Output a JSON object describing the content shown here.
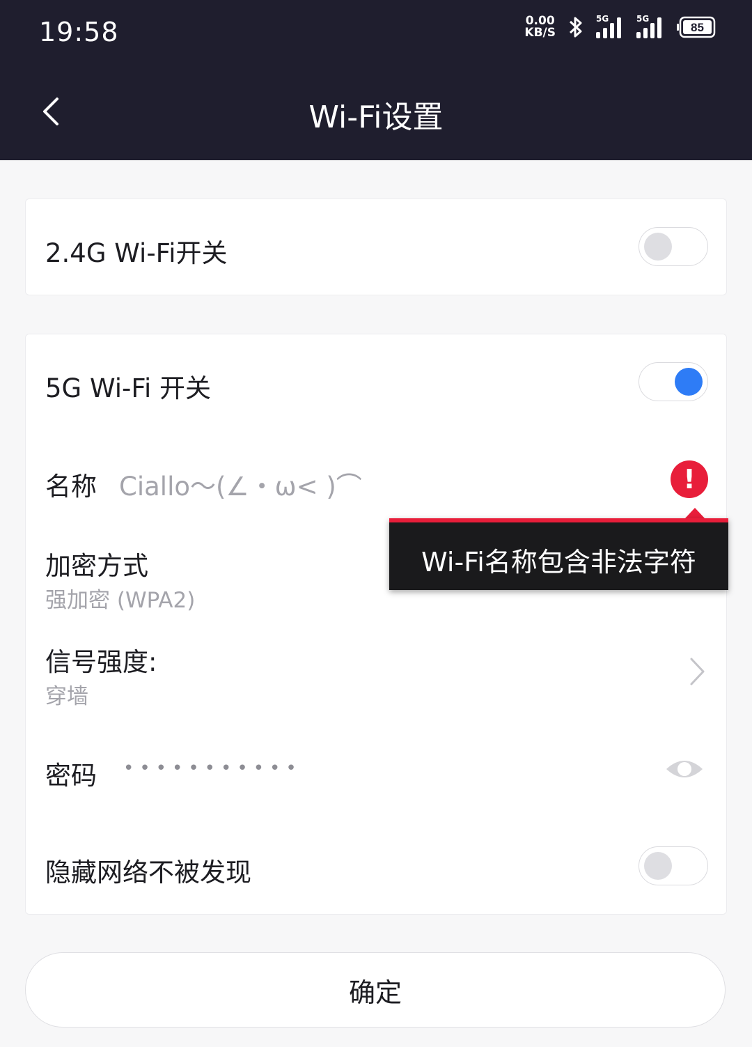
{
  "status_bar": {
    "time": "19:58",
    "net_speed_value": "0.00",
    "net_speed_unit": "KB/S",
    "signal1_label": "5G",
    "signal2_label": "5G",
    "battery": "85"
  },
  "header": {
    "title": "Wi-Fi设置",
    "back_icon": "chevron-left-icon"
  },
  "wifi_24g": {
    "label": "2.4G Wi-Fi开关",
    "enabled": false
  },
  "wifi_5g": {
    "label": "5G Wi-Fi 开关",
    "enabled": true,
    "name_label": "名称",
    "name_value": "Ciallo～(∠・ω< )⌒",
    "error_icon": "exclamation-icon",
    "encryption_label": "加密方式",
    "encryption_value": "强加密 (WPA2)",
    "signal_label": "信号强度:",
    "signal_value": "穿墙",
    "password_label": "密码",
    "password_value": "•••••••••••",
    "hide_label": "隐藏网络不被发现",
    "hide_enabled": false
  },
  "tooltip": {
    "text": "Wi-Fi名称包含非法字符"
  },
  "confirm_label": "确定",
  "colors": {
    "header_bg": "#1f1e2e",
    "accent": "#2e7cf6",
    "error": "#e81e3a"
  }
}
